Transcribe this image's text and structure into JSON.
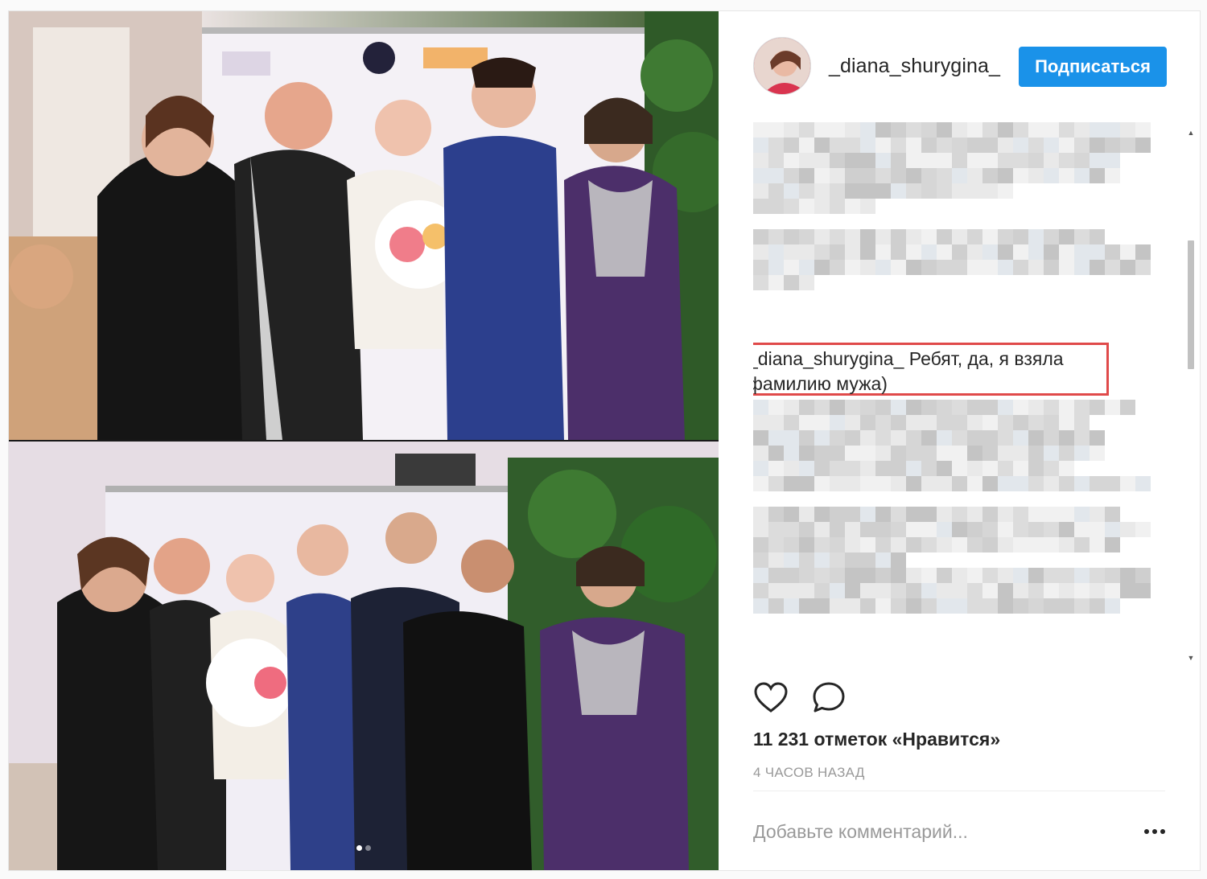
{
  "post": {
    "username": "_diana_shurygina_",
    "follow_label": "Подписаться",
    "caption": {
      "author": "_diana_shurygina_",
      "text": " Ребят, да, я взяла фамилию мужа)"
    },
    "likes_text": "11 231 отметок «Нравится»",
    "timestamp": "4 ЧАСОВ НАЗАД",
    "comment_placeholder": "Добавьте комментарий...",
    "carousel": {
      "total": 2,
      "active": 1
    }
  },
  "icons": {
    "avatar": "profile-photo",
    "like": "heart-icon",
    "comment": "speech-bubble-icon",
    "more": "more-dots-icon",
    "scroll_up": "scroll-up-arrow",
    "scroll_down": "scroll-down-arrow"
  },
  "colors": {
    "follow_button": "#1a92e9",
    "highlight_border": "#e04a4a",
    "muted_text": "#999999"
  }
}
